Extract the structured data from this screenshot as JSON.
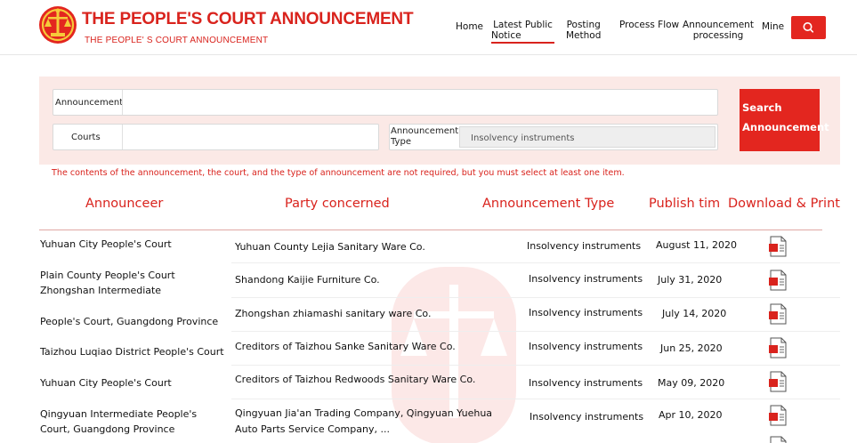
{
  "header": {
    "title": "THE PEOPLE'S COURT ANNOUNCEMENT",
    "subtitle": "THE PEOPLE' S COURT ANNOUNCEMENT",
    "logo_icon": "court-emblem-icon",
    "search_icon": "search-icon",
    "nav": [
      {
        "label_line1": "Home",
        "label_line2": ""
      },
      {
        "label_line1": "Latest Public",
        "label_line2": "Notice"
      },
      {
        "label_line1": "Posting",
        "label_line2": "Method"
      },
      {
        "label_line1": "Process Flow",
        "label_line2": ""
      },
      {
        "label_line1": "Announcement",
        "label_line2": "processing"
      },
      {
        "label_line1": "Mine",
        "label_line2": ""
      }
    ],
    "active_nav": "Latest Public Notice"
  },
  "search": {
    "announcement_label": "Announcement",
    "announcement_value": "",
    "courts_label": "Courts",
    "courts_value": "",
    "type_label_line1": "Announcement",
    "type_label_line2": "Type",
    "type_selected": "Insolvency instruments",
    "button_line1": "Search",
    "button_line2": "Announcement",
    "notice": "The contents of the announcement, the court, and the type of announcement are not required, but you must select at least one item."
  },
  "table": {
    "headers": [
      "Announceer",
      "Party concerned",
      "Announcement Type",
      "Publish tim",
      "Download & Print"
    ],
    "download_icon": "pdf-icon",
    "rows": [
      {
        "announcer": [
          "Yuhuan City People's Court"
        ],
        "party": [
          "Yuhuan County Lejia Sanitary Ware Co."
        ],
        "type": "Insolvency instruments",
        "date": "August 11, 2020"
      },
      {
        "announcer": [
          "Plain County People's Court",
          "Zhongshan Intermediate"
        ],
        "party": [
          "Shandong Kaijie Furniture Co."
        ],
        "type": "Insolvency instruments",
        "date": "July 31, 2020"
      },
      {
        "announcer": [
          "People's Court, Guangdong Province"
        ],
        "party": [
          "Zhongshan zhiamashi sanitary ware Co."
        ],
        "type": "Insolvency instruments",
        "date": "July 14, 2020"
      },
      {
        "announcer": [
          "Taizhou Luqiao District People's Court"
        ],
        "party": [
          "Creditors of Taizhou Sanke Sanitary Ware Co."
        ],
        "type": "Insolvency instruments",
        "date": "Jun 25, 2020"
      },
      {
        "announcer": [
          "Yuhuan City People's Court"
        ],
        "party": [
          "Creditors of Taizhou Redwoods Sanitary Ware Co."
        ],
        "type": "Insolvency instruments",
        "date": "May 09, 2020"
      },
      {
        "announcer": [
          "Qingyuan Intermediate People's",
          "Court, Guangdong Province"
        ],
        "party": [
          "Qingyuan Jia'an Trading Company, Qingyuan Yuehua",
          "Auto Parts Service Company, ..."
        ],
        "type": "Insolvency instruments",
        "date": "Apr 10, 2020"
      }
    ]
  },
  "colors": {
    "brand_red": "#d9231d",
    "panel_bg": "#fbe9e6",
    "button_red": "#e3261f"
  }
}
